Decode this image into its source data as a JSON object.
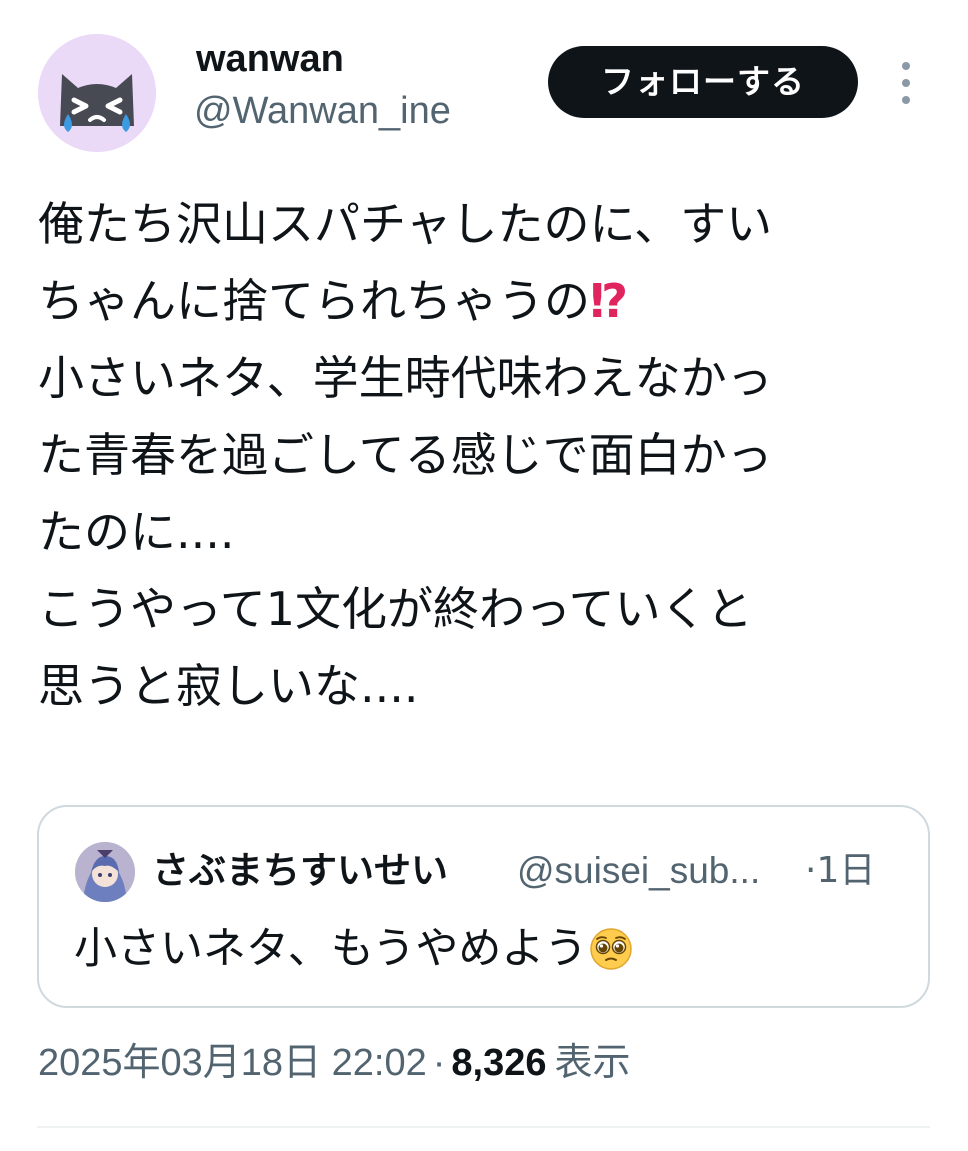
{
  "author": {
    "display_name": "wanwan",
    "handle": "@Wanwan_ine",
    "avatar_icon": "crying-cat-icon",
    "avatar_bg": "#ead9f7"
  },
  "actions": {
    "follow_label": "フォローする",
    "more_icon": "more-vertical-icon"
  },
  "tweet": {
    "lines": [
      "俺たち沢山スパチャしたのに、すい",
      "ちゃんに捨てられちゃうの",
      "小さいネタ、学生時代味わえなかっ",
      "た青春を過ごしてる感じで面白かっ",
      "たのに....",
      "こうやって1文化が終わっていくと",
      "思うと寂しいな...."
    ],
    "emoji": "⁉",
    "emoji_color": "#e0245e"
  },
  "quote": {
    "display_name": "さぶまちすいせい",
    "handle": "@suisei_sub...",
    "time": "·1日",
    "text": "小さいネタ、もうやめよう",
    "emoji_icon": "pleading-face-icon"
  },
  "meta": {
    "timestamp": "2025年03月18日 22:02",
    "separator": "·",
    "view_count": "8,326",
    "view_label": "表示"
  },
  "colors": {
    "text_primary": "#0f1419",
    "text_secondary": "#536471",
    "border": "#cfd9de",
    "button_bg": "#0f1419"
  }
}
